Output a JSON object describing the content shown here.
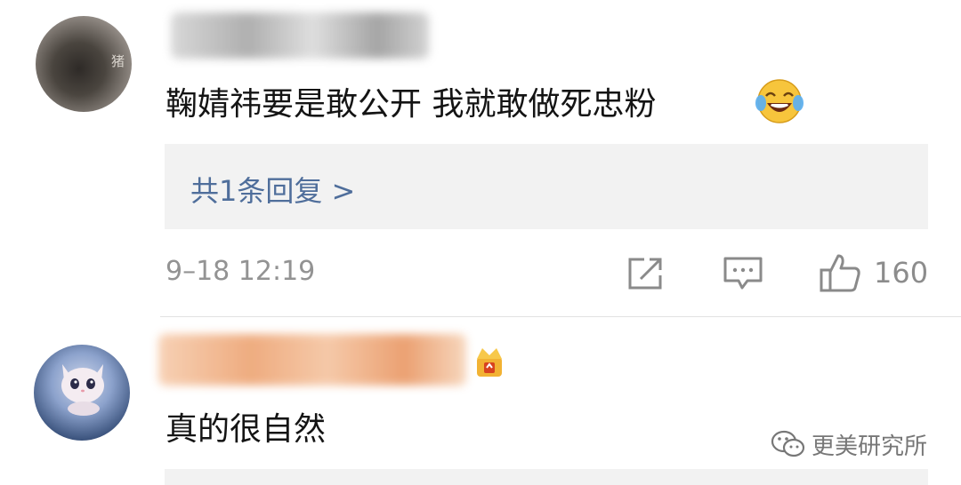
{
  "comments": [
    {
      "avatar_tag": "猪",
      "text": "鞠婧祎要是敢公开 我就敢做死忠粉",
      "emoji": "laughing-crying-emoji",
      "replies_link": "共1条回复 >",
      "timestamp": "9–18 12:19",
      "like_count": "160"
    },
    {
      "text": "真的很自然"
    }
  ],
  "watermark": {
    "text": "更美研究所"
  },
  "colors": {
    "link": "#4f6e9b",
    "meta": "#939393",
    "reply_bg": "#f2f2f2",
    "text": "#141414"
  }
}
